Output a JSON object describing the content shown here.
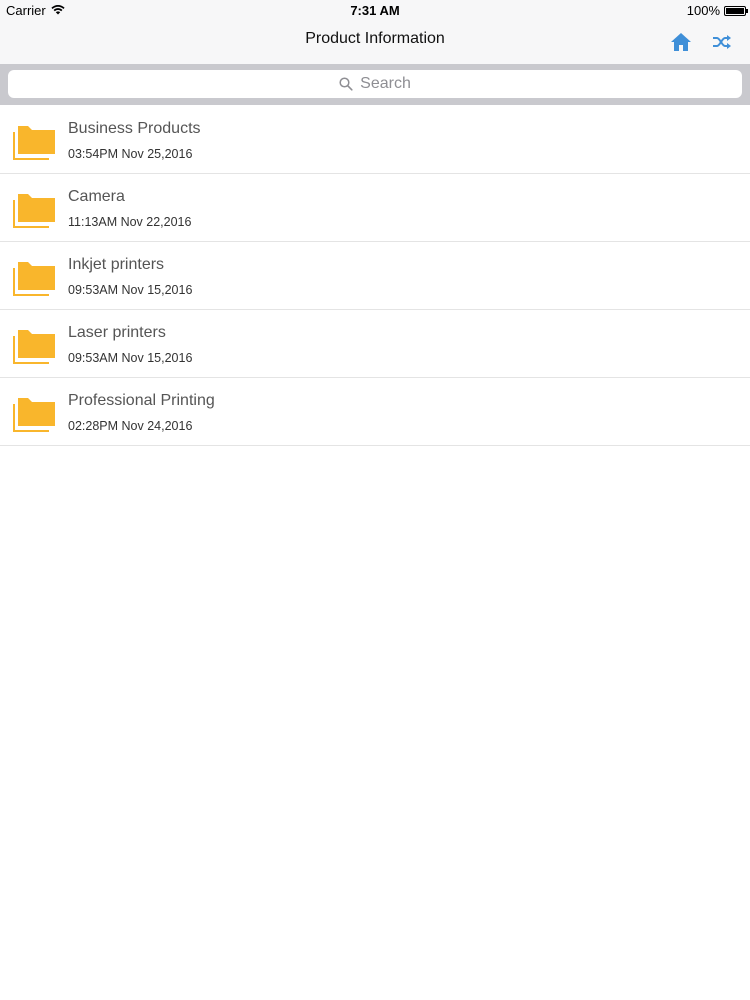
{
  "status_bar": {
    "carrier": "Carrier",
    "time": "7:31 AM",
    "battery": "100%"
  },
  "nav": {
    "title": "Product Information",
    "home_icon": "home-icon",
    "shuffle_icon": "shuffle-icon"
  },
  "search": {
    "placeholder": "Search",
    "icon": "search-icon"
  },
  "colors": {
    "folder": "#f9b62c",
    "accent": "#3f8fd8"
  },
  "folders": [
    {
      "name": "Business Products",
      "date": "03:54PM Nov 25,2016"
    },
    {
      "name": "Camera",
      "date": "11:13AM Nov 22,2016"
    },
    {
      "name": "Inkjet printers",
      "date": "09:53AM Nov 15,2016"
    },
    {
      "name": "Laser printers",
      "date": "09:53AM Nov 15,2016"
    },
    {
      "name": "Professional Printing",
      "date": "02:28PM Nov 24,2016"
    }
  ]
}
